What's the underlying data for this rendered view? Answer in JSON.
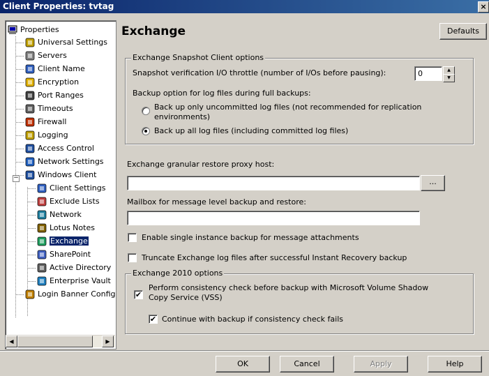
{
  "window": {
    "title": "Client Properties: tvtag",
    "close_glyph": "×"
  },
  "tree": {
    "root_label": "Properties",
    "items": [
      {
        "label": "Universal Settings",
        "icon": "universal-settings-icon"
      },
      {
        "label": "Servers",
        "icon": "servers-icon"
      },
      {
        "label": "Client Name",
        "icon": "client-name-icon"
      },
      {
        "label": "Encryption",
        "icon": "lock-icon"
      },
      {
        "label": "Port Ranges",
        "icon": "port-ranges-icon"
      },
      {
        "label": "Timeouts",
        "icon": "clock-icon"
      },
      {
        "label": "Firewall",
        "icon": "firewall-icon"
      },
      {
        "label": "Logging",
        "icon": "logging-icon"
      },
      {
        "label": "Access Control",
        "icon": "access-control-icon"
      },
      {
        "label": "Network Settings",
        "icon": "network-settings-icon"
      },
      {
        "label": "Windows Client",
        "icon": "windows-client-icon"
      }
    ],
    "windows_children": [
      {
        "label": "Client Settings",
        "icon": "client-settings-icon"
      },
      {
        "label": "Exclude Lists",
        "icon": "exclude-lists-icon"
      },
      {
        "label": "Network",
        "icon": "network-icon"
      },
      {
        "label": "Lotus Notes",
        "icon": "lotus-notes-icon"
      },
      {
        "label": "Exchange",
        "icon": "exchange-icon",
        "selected": true
      },
      {
        "label": "SharePoint",
        "icon": "sharepoint-icon"
      },
      {
        "label": "Active Directory",
        "icon": "active-directory-icon"
      },
      {
        "label": "Enterprise Vault",
        "icon": "enterprise-vault-icon"
      }
    ],
    "last_item": {
      "label": "Login Banner Configuration",
      "icon": "login-banner-icon"
    },
    "expander_minus": "−",
    "scroll_left": "◀",
    "scroll_right": "▶"
  },
  "panel": {
    "title": "Exchange",
    "defaults_button": "Defaults",
    "snapshot_group": {
      "label": "Exchange Snapshot Client options",
      "throttle_label": "Snapshot verification I/O throttle (number of I/Os before pausing):",
      "throttle_value": "0",
      "backup_option_label": "Backup option for log files during full backups:",
      "radio1_line1": "Back up only uncommitted log files (not recommended for replication",
      "radio1_line2": "environments)",
      "radio2": "Back up all log files (including committed log files)",
      "radio1_selected": false,
      "radio2_selected": true
    },
    "proxy_label": "Exchange granular restore proxy host:",
    "proxy_value": "",
    "browse_button": "...",
    "mailbox_label": "Mailbox for message level backup and restore:",
    "mailbox_value": "",
    "single_instance_label": "Enable single instance backup for message attachments",
    "single_instance_checked": false,
    "truncate_label": "Truncate Exchange log files after successful Instant Recovery backup",
    "truncate_checked": false,
    "exchange2010_group": {
      "label": "Exchange 2010 options",
      "consistency_line1": "Perform consistency check before backup with Microsoft Volume Shadow",
      "consistency_line2": "Copy Service (VSS)",
      "consistency_checked": true,
      "continue_label": "Continue with backup if consistency check fails",
      "continue_checked": true
    }
  },
  "buttons": {
    "ok": "OK",
    "cancel": "Cancel",
    "apply": "Apply",
    "help": "Help"
  },
  "check_glyph": "✔",
  "spin_up": "▲",
  "spin_down": "▼"
}
